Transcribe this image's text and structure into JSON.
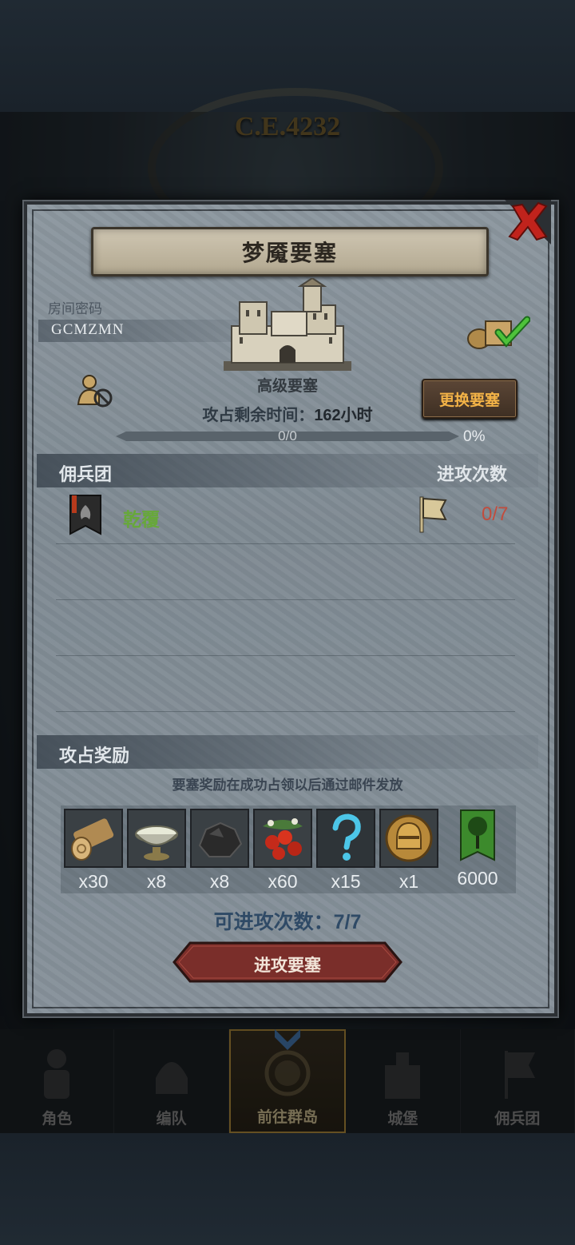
{
  "background": {
    "era_text": "C.E.4232"
  },
  "bottom_nav": {
    "items": [
      {
        "label": "角色"
      },
      {
        "label": "编队"
      },
      {
        "label": "前往群岛"
      },
      {
        "label": "城堡"
      },
      {
        "label": "佣兵团"
      }
    ],
    "active_index": 2
  },
  "dialog": {
    "title": "梦魇要塞",
    "room_password_label": "房间密码",
    "room_password": "GCMZMN",
    "fortress_type": "高级要塞",
    "time_remaining_label": "攻占剩余时间：",
    "time_remaining_value": "162小时",
    "change_fortress_button": "更换要塞",
    "progress": {
      "text": "0/0",
      "percent_text": "0%",
      "fraction": 0
    },
    "legion_header": "佣兵团",
    "attack_count_header": "进攻次数",
    "legions": [
      {
        "name": "乾覆",
        "attacks": "0/7"
      }
    ],
    "rewards_header": "攻占奖励",
    "rewards_note": "要塞奖励在成功占领以后通过邮件发放",
    "rewards": [
      {
        "icon": "wood-log-icon",
        "qty": "x30"
      },
      {
        "icon": "silver-bowl-icon",
        "qty": "x8"
      },
      {
        "icon": "ore-rock-icon",
        "qty": "x8"
      },
      {
        "icon": "berries-icon",
        "qty": "x60"
      },
      {
        "icon": "mystery-question-icon",
        "qty": "x15"
      },
      {
        "icon": "gold-helmet-icon",
        "qty": "x1"
      },
      {
        "icon": "tree-banner-icon",
        "qty": "6000"
      }
    ],
    "attacks_available_label": "可进攻次数：",
    "attacks_available_value": "7/7",
    "attack_button": "进攻要塞"
  },
  "colors": {
    "legion_name": "#67a83a",
    "attack_count": "#c24c3d",
    "change_button_text": "#f3b347",
    "attack_button": "#7a2e2a"
  }
}
